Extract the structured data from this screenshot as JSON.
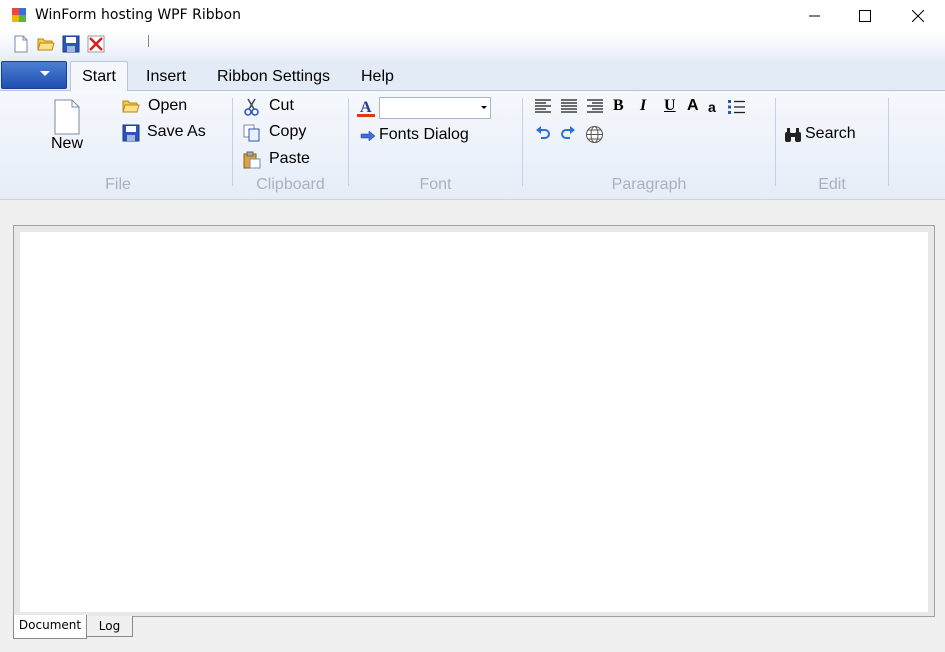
{
  "window": {
    "title": "WinForm hosting WPF Ribbon"
  },
  "quick_access": {
    "icons": [
      "new-document-icon",
      "open-folder-icon",
      "save-icon",
      "close-icon"
    ]
  },
  "tabs": [
    {
      "label": "Start",
      "active": true
    },
    {
      "label": "Insert",
      "active": false
    },
    {
      "label": "Ribbon Settings",
      "active": false
    },
    {
      "label": "Help",
      "active": false
    }
  ],
  "ribbon": {
    "file": {
      "label": "File",
      "new_label": "New",
      "open_label": "Open",
      "save_as_label": "Save As"
    },
    "clipboard": {
      "label": "Clipboard",
      "cut_label": "Cut",
      "copy_label": "Copy",
      "paste_label": "Paste"
    },
    "font": {
      "label": "Font",
      "font_combo_value": "",
      "fonts_dialog_label": "Fonts Dialog",
      "font_color": "#e0371b"
    },
    "paragraph": {
      "label": "Paragraph",
      "bold_glyph": "B",
      "italic_glyph": "I",
      "underline_glyph": "U",
      "grow_glyph": "A",
      "shrink_glyph": "a"
    },
    "edit": {
      "label": "Edit",
      "search_label": "Search"
    }
  },
  "bottom_tabs": [
    {
      "label": "Document",
      "active": true
    },
    {
      "label": "Log",
      "active": false
    }
  ],
  "colors": {
    "accent": "#2a5db8",
    "ribbon_bg": "#e6edf8",
    "group_label": "#a9b2be"
  }
}
